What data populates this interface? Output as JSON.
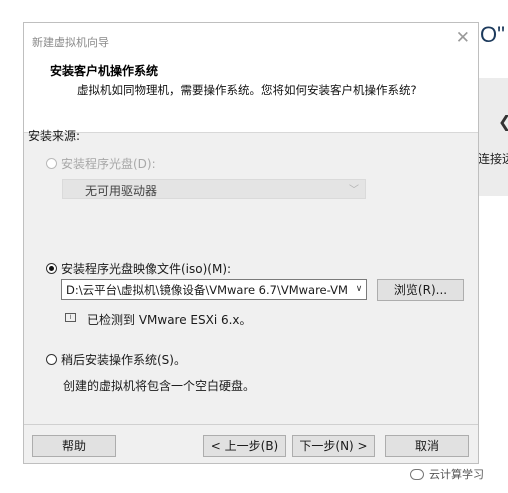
{
  "background": {
    "title_fragment": "O\"",
    "arrow_glyph": "❮",
    "text_fragment": "连接远"
  },
  "dialog": {
    "title": "新建虚拟机向导",
    "header": {
      "title": "安装客户机操作系统",
      "subtitle": "虚拟机如同物理机，需要操作系统。您将如何安装客户机操作系统?"
    },
    "section_label": "安装来源:",
    "options": {
      "disc": {
        "label": "安装程序光盘(D):",
        "enabled": false,
        "selected": false,
        "drive_value": "无可用驱动器"
      },
      "iso": {
        "label": "安装程序光盘映像文件(iso)(M):",
        "selected": true,
        "path_value": "D:\\云平台\\虚拟机\\镜像设备\\VMware 6.7\\VMware-VM",
        "browse_label": "浏览(R)...",
        "detect_text": "已检测到 VMware ESXi 6.x。"
      },
      "later": {
        "label": "稍后安装操作系统(S)。",
        "selected": false,
        "description": "创建的虚拟机将包含一个空白硬盘。"
      }
    },
    "buttons": {
      "help": "帮助",
      "back": "< 上一步(B)",
      "next": "下一步(N) >",
      "cancel": "取消"
    }
  },
  "watermark": "云计算学习"
}
